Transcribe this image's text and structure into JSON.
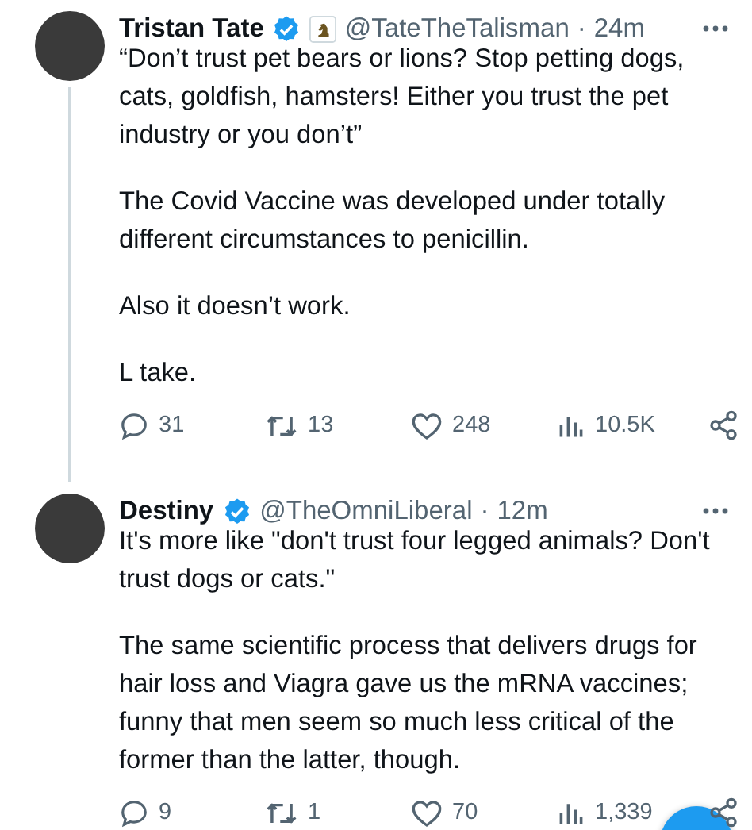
{
  "tweets": [
    {
      "name": "Tristan Tate",
      "verified": true,
      "affiliate_badge": true,
      "handle": "@TateTheTalisman",
      "separator": "·",
      "time": "24m",
      "thread": true,
      "paragraphs": [
        "“Don’t trust pet bears or lions? Stop petting dogs, cats, goldfish, hamsters! Either you trust the pet industry or you don’t”",
        "The Covid Vaccine was developed under totally different circumstances to penicillin.",
        "Also it doesn’t work.",
        "L take."
      ],
      "actions": [
        {
          "kind": "reply",
          "count": "31"
        },
        {
          "kind": "retweet",
          "count": "13"
        },
        {
          "kind": "like",
          "count": "248"
        },
        {
          "kind": "views",
          "count": "10.5K"
        },
        {
          "kind": "share"
        }
      ]
    },
    {
      "name": "Destiny",
      "verified": true,
      "affiliate_badge": false,
      "handle": "@TheOmniLiberal",
      "separator": "·",
      "time": "12m",
      "thread": false,
      "paragraphs": [
        "It's more like \"don't trust four legged animals? Don't trust dogs or cats.\"",
        "The same scientific process that delivers drugs for hair loss and Viagra gave us the mRNA vaccines; funny that men seem so much less critical of the former than the latter, though."
      ],
      "actions": [
        {
          "kind": "reply",
          "count": "9"
        },
        {
          "kind": "retweet",
          "count": "1"
        },
        {
          "kind": "like",
          "count": "70"
        },
        {
          "kind": "views",
          "count": "1,339"
        },
        {
          "kind": "share"
        }
      ]
    }
  ]
}
